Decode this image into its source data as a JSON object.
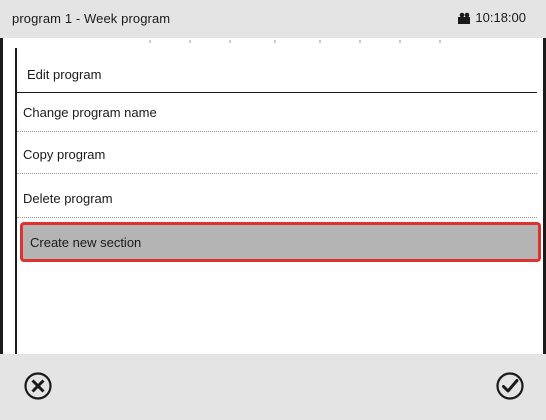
{
  "header": {
    "title": "program 1 - Week program",
    "time": "10:18:00"
  },
  "menu": {
    "header_item": "Edit program",
    "items": [
      {
        "label": "Change program name"
      },
      {
        "label": "Copy program"
      },
      {
        "label": "Delete program"
      },
      {
        "label": "Create new section"
      }
    ],
    "selected_index": 3
  },
  "footer": {
    "cancel_icon": "close-circle-icon",
    "confirm_icon": "check-circle-icon"
  },
  "colors": {
    "bar_bg": "#e4e4e4",
    "selected_bg": "#b4b4b4",
    "selected_border": "#e0312f"
  }
}
